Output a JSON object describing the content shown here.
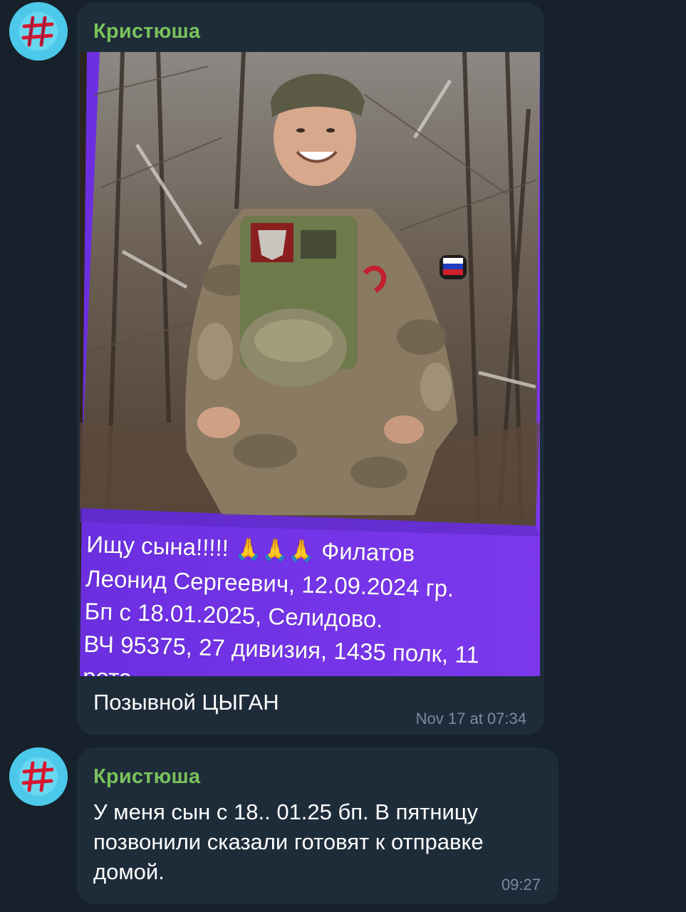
{
  "messages": [
    {
      "sender": "Кристюша",
      "photo_overlay_lines": [
        "Ищу сына!!!!!",
        "Филатов",
        "Леонид Сергеевич, 12.09.2024 гр.",
        "Бп с 18.01.2025, Селидово.",
        "ВЧ 95375, 27 дивизия, 1435 полк, 11",
        "рота ."
      ],
      "pray_emoji": "🙏🙏🙏",
      "caption": "Позывной ЦЫГАН",
      "time": "Nov 17 at 07:34"
    },
    {
      "sender": "Кристюша",
      "text": "У меня сын с 18.. 01.25 бп. В пятницу позвонили сказали готовят к отправке домой.",
      "time": "09:27"
    }
  ],
  "colors": {
    "background": "#17212b",
    "bubble": "#1e2c3a",
    "sender_name": "#79c25b",
    "timestamp": "#7b8c9e",
    "overlay_purple": "#7a35e8"
  },
  "icons": {
    "avatar": "hashtag-avatar-icon"
  }
}
